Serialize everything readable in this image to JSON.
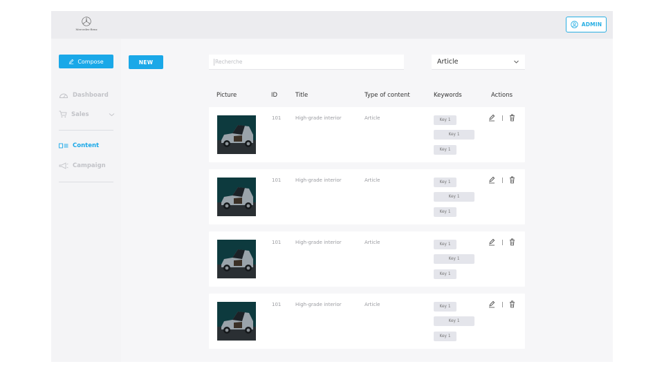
{
  "brand": {
    "name": "Mercedes-Benz"
  },
  "header": {
    "admin_label": "ADMIN"
  },
  "sidebar": {
    "compose_label": "Compose",
    "items": [
      {
        "label": "Dashboard",
        "icon": "dashboard-icon"
      },
      {
        "label": "Sales",
        "icon": "cart-icon"
      },
      {
        "label": "Content",
        "icon": "content-icon"
      },
      {
        "label": "Campaign",
        "icon": "megaphone-icon"
      }
    ]
  },
  "toolbar": {
    "new_label": "NEW",
    "search_placeholder": "Recherche",
    "filter_value": "Article"
  },
  "table": {
    "headers": [
      "Picture",
      "ID",
      "Title",
      "Type of content",
      "Keywords",
      "Actions"
    ],
    "rows": [
      {
        "id": "101",
        "title": "High-grade interior",
        "type": "Article",
        "keywords": [
          "Key 1",
          "Key 1",
          "Key 1"
        ]
      },
      {
        "id": "101",
        "title": "High-grade interior",
        "type": "Article",
        "keywords": [
          "Key 1",
          "Key 1",
          "Key 1"
        ]
      },
      {
        "id": "101",
        "title": "High-grade interior",
        "type": "Article",
        "keywords": [
          "Key 1",
          "Key 1",
          "Key 1"
        ]
      },
      {
        "id": "101",
        "title": "High-grade interior",
        "type": "Article",
        "keywords": [
          "Key 1",
          "Key 1",
          "Key 1"
        ]
      }
    ]
  },
  "colors": {
    "accent": "#1aa8e8",
    "admin_border": "#27aee3",
    "muted": "#c2c3c8"
  }
}
